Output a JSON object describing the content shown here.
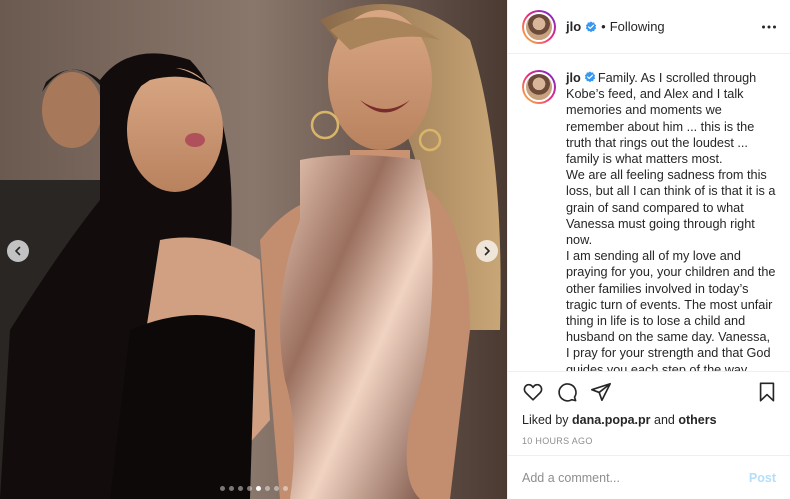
{
  "media": {
    "slide_count": 8,
    "active_slide": 5
  },
  "header": {
    "username": "jlo",
    "separator": "•",
    "follow_state": "Following"
  },
  "caption": {
    "username": "jlo",
    "paragraphs": [
      "Family. As I scrolled through Kobe’s feed, and Alex and I talk memories and moments we remember about him ... this is the truth that rings out the loudest ... family is what matters most.",
      "We are all feeling sadness from this loss, but all I can think of is that it is a grain of sand compared to what Vanessa must going through right now.",
      "I am sending all of my love and praying for you, your children and the other families involved in today’s tragic turn of events. The most unfair thing in life is to lose a child and husband on the same day. Vanessa, I pray for your strength and that God guides you each step of the way through this unimaginable heartbreak."
    ]
  },
  "likes": {
    "prefix": "Liked by",
    "user": "dana.popa.pr",
    "conjunction": "and",
    "others": "others"
  },
  "timestamp": "10 HOURS AGO",
  "comment": {
    "placeholder": "Add a comment...",
    "post_label": "Post"
  },
  "colors": {
    "verified": "#3897f0",
    "post_button_disabled": "#b2dffc",
    "text": "#262626",
    "muted": "#8e8e8e"
  },
  "icons": [
    "more-options-icon",
    "heart-icon",
    "comment-icon",
    "share-icon",
    "bookmark-icon",
    "chevron-left-icon",
    "chevron-right-icon",
    "verified-badge-icon"
  ]
}
